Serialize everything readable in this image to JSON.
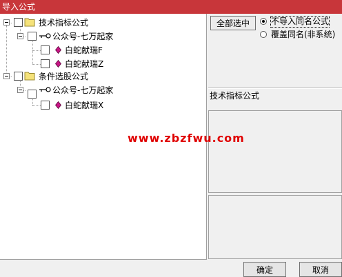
{
  "window": {
    "title": "导入公式"
  },
  "tree": {
    "nodes": [
      {
        "label": "技术指标公式",
        "type": "category"
      },
      {
        "label": "公众号-七万起家",
        "type": "group"
      },
      {
        "label": "白蛇献瑞F",
        "type": "formula"
      },
      {
        "label": "白蛇献瑞Z",
        "type": "formula"
      },
      {
        "label": "条件选股公式",
        "type": "category"
      },
      {
        "label": "公众号-七万起家",
        "type": "group"
      },
      {
        "label": "白蛇献瑞X",
        "type": "formula"
      }
    ]
  },
  "options": {
    "select_all_label": "全部选中",
    "radio_skip_label": "不导入同名公式",
    "radio_overwrite_label": "覆盖同名(非系统)",
    "selected": "不导入同名公式"
  },
  "detail": {
    "section_label": "技术指标公式"
  },
  "watermark": "www.zbzfwu.com",
  "footer": {
    "ok_label": "确定",
    "cancel_label": "取消"
  },
  "colors": {
    "titlebar": "#c8363a",
    "watermark": "#e00000",
    "folder": "#f5e27a",
    "formula_icon": "#c71585"
  }
}
